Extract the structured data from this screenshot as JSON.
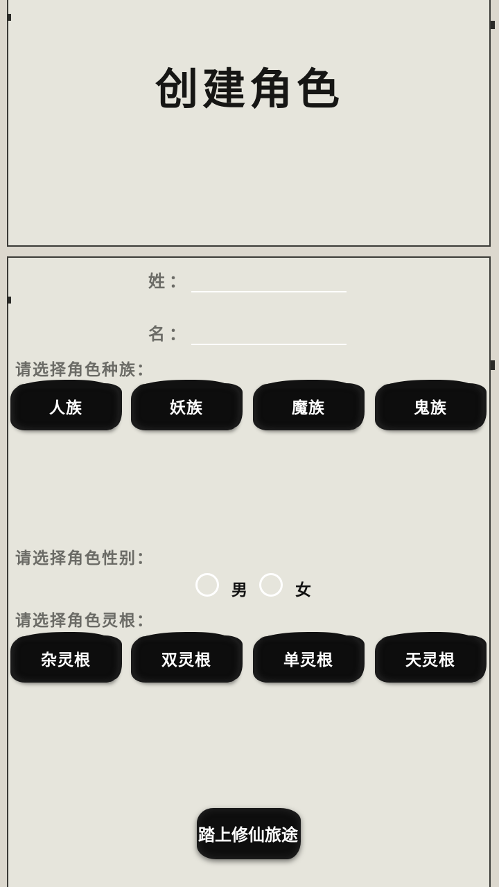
{
  "header": {
    "title": "创建角色"
  },
  "name_form": {
    "surname_label": "姓：",
    "surname_value": "",
    "given_name_label": "名：",
    "given_name_value": ""
  },
  "race": {
    "prompt": "请选择角色种族：",
    "options": [
      "人族",
      "妖族",
      "魔族",
      "鬼族"
    ]
  },
  "gender": {
    "prompt": "请选择角色性别：",
    "options": [
      "男",
      "女"
    ]
  },
  "spirit_root": {
    "prompt": "请选择角色灵根：",
    "options": [
      "杂灵根",
      "双灵根",
      "单灵根",
      "天灵根"
    ]
  },
  "start_button": {
    "label": "踏上修仙旅途"
  },
  "colors": {
    "paper": "#e6e5dc",
    "ink": "#0d0d0d",
    "label_gray": "#6b6b66",
    "line_white": "#ffffff"
  }
}
